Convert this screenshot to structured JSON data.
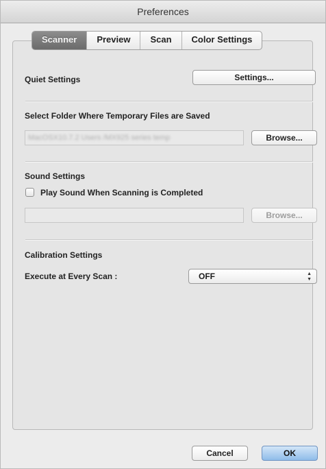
{
  "window": {
    "title": "Preferences"
  },
  "tabs": [
    {
      "label": "Scanner",
      "active": true
    },
    {
      "label": "Preview",
      "active": false
    },
    {
      "label": "Scan",
      "active": false
    },
    {
      "label": "Color Settings",
      "active": false
    }
  ],
  "quiet": {
    "label": "Quiet Settings",
    "button": "Settings..."
  },
  "temp_folder": {
    "label": "Select Folder Where Temporary Files are Saved",
    "path": "MacOSX10.7.2 Users  /MX925 series temp",
    "browse": "Browse..."
  },
  "sound": {
    "label": "Sound Settings",
    "checkbox_label": "Play Sound When Scanning is Completed",
    "checked": false,
    "path": "",
    "browse": "Browse..."
  },
  "calibration": {
    "label": "Calibration Settings",
    "execute_label": "Execute at Every Scan :",
    "value": "OFF"
  },
  "footer": {
    "cancel": "Cancel",
    "ok": "OK"
  },
  "colors": {
    "default_button": "#8fbce9",
    "active_tab": "#7a7a7a"
  }
}
